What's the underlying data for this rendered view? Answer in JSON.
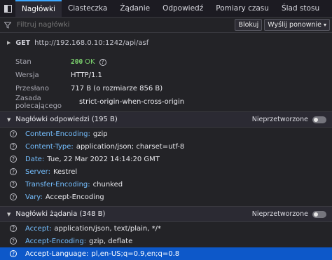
{
  "tabs": [
    {
      "label": "Nagłówki",
      "active": true
    },
    {
      "label": "Ciasteczka",
      "active": false
    },
    {
      "label": "Żądanie",
      "active": false
    },
    {
      "label": "Odpowiedź",
      "active": false
    },
    {
      "label": "Pomiary czasu",
      "active": false
    },
    {
      "label": "Ślad stosu",
      "active": false
    }
  ],
  "filter": {
    "placeholder": "Filtruj nagłówki",
    "block_label": "Blokuj",
    "resend_label": "Wyślij ponownie"
  },
  "request": {
    "method": "GET",
    "url": "http://192.168.0.10:1242/api/asf"
  },
  "summary": {
    "status_key": "Stan",
    "status_code": "200",
    "status_text": "OK",
    "version_key": "Wersja",
    "version_val": "HTTP/1.1",
    "transfer_key": "Przesłano",
    "transfer_val": "717 B (o rozmiarze 856 B)",
    "referrer_key": "Zasada polecającego",
    "referrer_val": "strict-origin-when-cross-origin"
  },
  "response_headers": {
    "title": "Nagłówki odpowiedzi (195 B)",
    "raw_label": "Nieprzetworzone",
    "raw_on": false,
    "items": [
      {
        "name": "Content-Encoding:",
        "value": "gzip"
      },
      {
        "name": "Content-Type:",
        "value": "application/json; charset=utf-8"
      },
      {
        "name": "Date:",
        "value": "Tue, 22 Mar 2022 14:14:20 GMT"
      },
      {
        "name": "Server:",
        "value": "Kestrel"
      },
      {
        "name": "Transfer-Encoding:",
        "value": "chunked"
      },
      {
        "name": "Vary:",
        "value": "Accept-Encoding"
      }
    ]
  },
  "request_headers": {
    "title": "Nagłówki żądania (348 B)",
    "raw_label": "Nieprzetworzone",
    "raw_on": false,
    "items": [
      {
        "name": "Accept:",
        "value": "application/json, text/plain, */*"
      },
      {
        "name": "Accept-Encoding:",
        "value": "gzip, deflate"
      },
      {
        "name": "Accept-Language:",
        "value": "pl,en-US;q=0.9,en;q=0.8"
      }
    ]
  },
  "icons": {
    "inspector": "inspector-icon",
    "filter": "filter-icon",
    "help": "question-circle-icon",
    "expand": "triangle-icon"
  }
}
